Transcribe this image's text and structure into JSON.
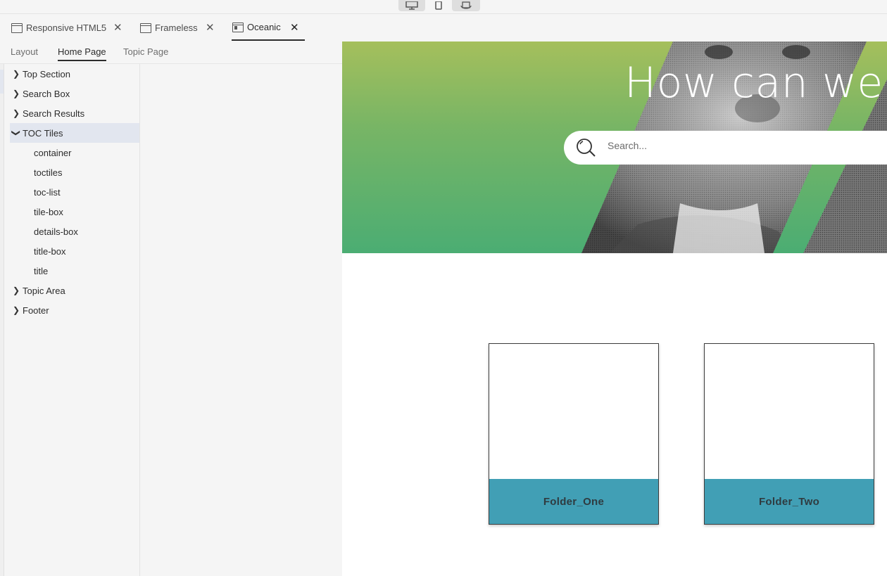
{
  "device_bar": {
    "buttons": [
      {
        "name": "desktop-view-icon",
        "active": true
      },
      {
        "name": "mobile-view-icon",
        "active": false
      },
      {
        "name": "tablet-rotate-icon",
        "active": true
      }
    ]
  },
  "doc_tabs": [
    {
      "label": "Responsive HTML5",
      "icon": "window-icon",
      "active": false
    },
    {
      "label": "Frameless",
      "icon": "window-icon",
      "active": false
    },
    {
      "label": "Oceanic",
      "icon": "book-window-icon",
      "active": true
    }
  ],
  "sub_tabs": [
    {
      "label": "Layout",
      "active": false
    },
    {
      "label": "Home Page",
      "active": true
    },
    {
      "label": "Topic Page",
      "active": false
    }
  ],
  "tree": {
    "items": [
      {
        "label": "Top Section",
        "expanded": false
      },
      {
        "label": "Search Box",
        "expanded": false
      },
      {
        "label": "Search Results",
        "expanded": false
      },
      {
        "label": "TOC Tiles",
        "expanded": true,
        "selected": true,
        "children": [
          "container",
          "toctiles",
          "toc-list",
          "tile-box",
          "details-box",
          "title-box",
          "title"
        ]
      },
      {
        "label": "Topic Area",
        "expanded": false
      },
      {
        "label": "Footer",
        "expanded": false
      }
    ]
  },
  "preview": {
    "hero_title": "How can we he",
    "search_placeholder": "Search...",
    "tiles": [
      {
        "title": "Folder_One"
      },
      {
        "title": "Folder_Two"
      }
    ],
    "colors": {
      "hero_gradient_top": "#a5bf5c",
      "hero_gradient_bottom": "#4bad73",
      "tile_footer": "#419fb5"
    }
  }
}
